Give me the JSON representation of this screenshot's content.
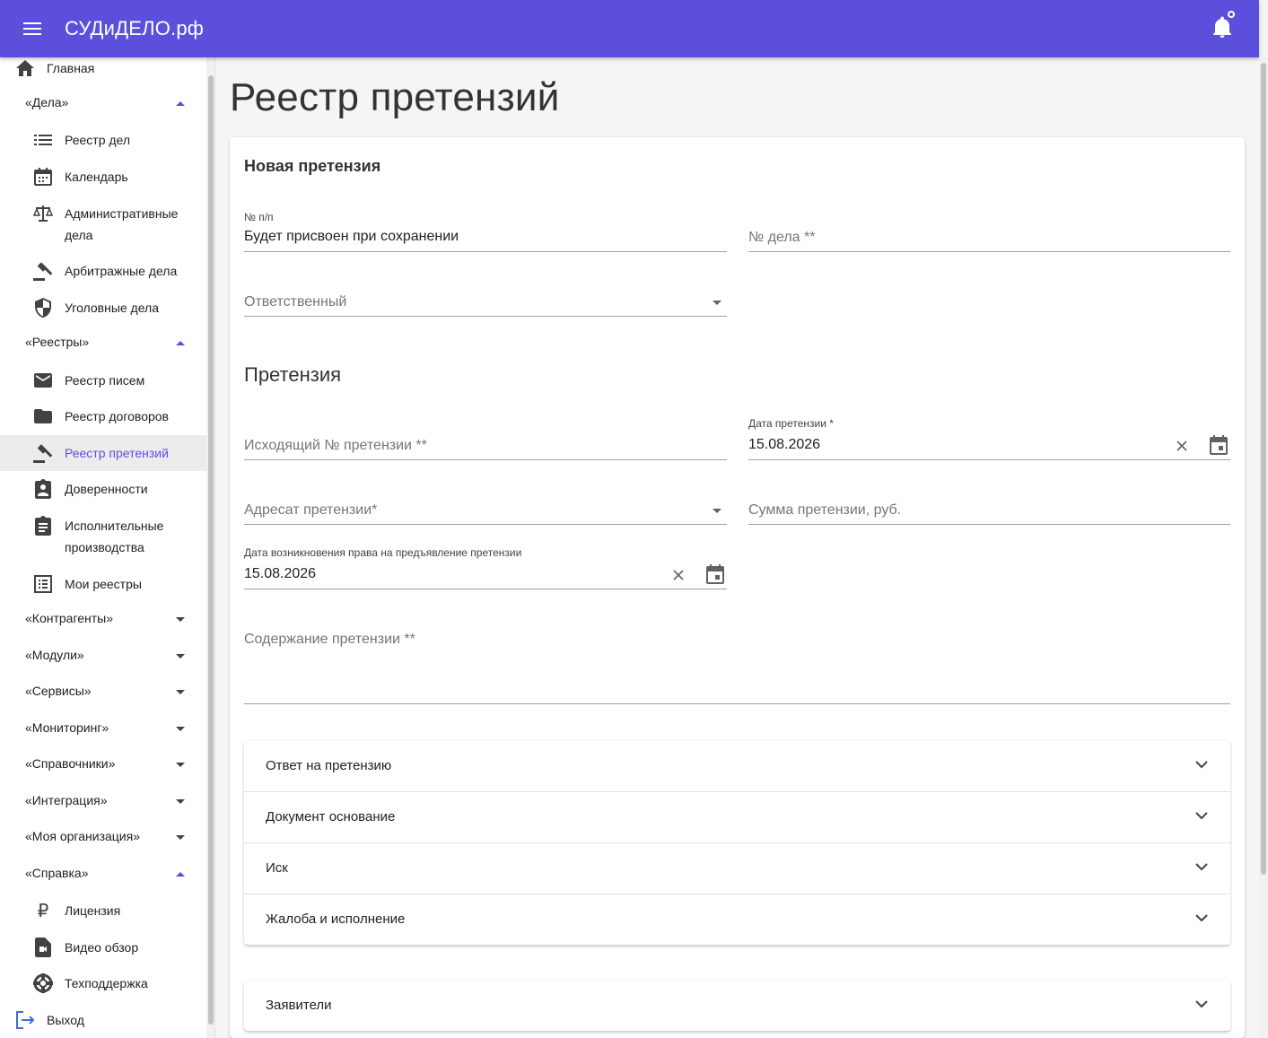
{
  "app": {
    "title": "СУДиДЕЛО.рф"
  },
  "sidebar": {
    "home": "Главная",
    "groups": {
      "cases": "«Дела»",
      "registries": "«Реестры»",
      "counterparties": "«Контрагенты»",
      "modules": "«Модули»",
      "services": "«Сервисы»",
      "monitoring": "«Мониторинг»",
      "references": "«Справочники»",
      "integration": "«Интеграция»",
      "my_org": "«Моя организация»",
      "help": "«Справка»"
    },
    "items": {
      "case_registry": "Реестр дел",
      "calendar": "Календарь",
      "admin_cases_1": "Административные",
      "admin_cases_2": "дела",
      "arbitration": "Арбитражные дела",
      "criminal": "Уголовные дела",
      "letters": "Реестр писем",
      "contracts": "Реестр договоров",
      "claims": "Реестр претензий",
      "poa": "Доверенности",
      "enforcement_1": "Исполнительные",
      "enforcement_2": "производства",
      "my_registries": "Мои реестры",
      "license": "Лицензия",
      "video": "Видео обзор",
      "support": "Техподдержка",
      "logout": "Выход"
    }
  },
  "page": {
    "title": "Реестр претензий",
    "card_title": "Новая претензия",
    "section_title": "Претензия",
    "fields": {
      "number_label": "№ п/п",
      "number_value": "Будет присвоен при сохранении",
      "case_number_placeholder": "№ дела **",
      "responsible_placeholder": "Ответственный",
      "outgoing_placeholder": "Исходящий № претензии **",
      "claim_date_label": "Дата претензии *",
      "claim_date_value": "15.08.2026",
      "addressee_placeholder": "Адресат претензии*",
      "amount_placeholder": "Сумма претензии, руб.",
      "right_date_label": "Дата возникновения права на предъявление претензии",
      "right_date_value": "15.08.2026",
      "content_placeholder": "Содержание претензии **"
    },
    "panels": [
      "Ответ на претензию",
      "Документ основание",
      "Иск",
      "Жалоба и исполнение"
    ],
    "panel_applicants": "Заявители"
  },
  "colors": {
    "primary": "#5c4fdc"
  }
}
